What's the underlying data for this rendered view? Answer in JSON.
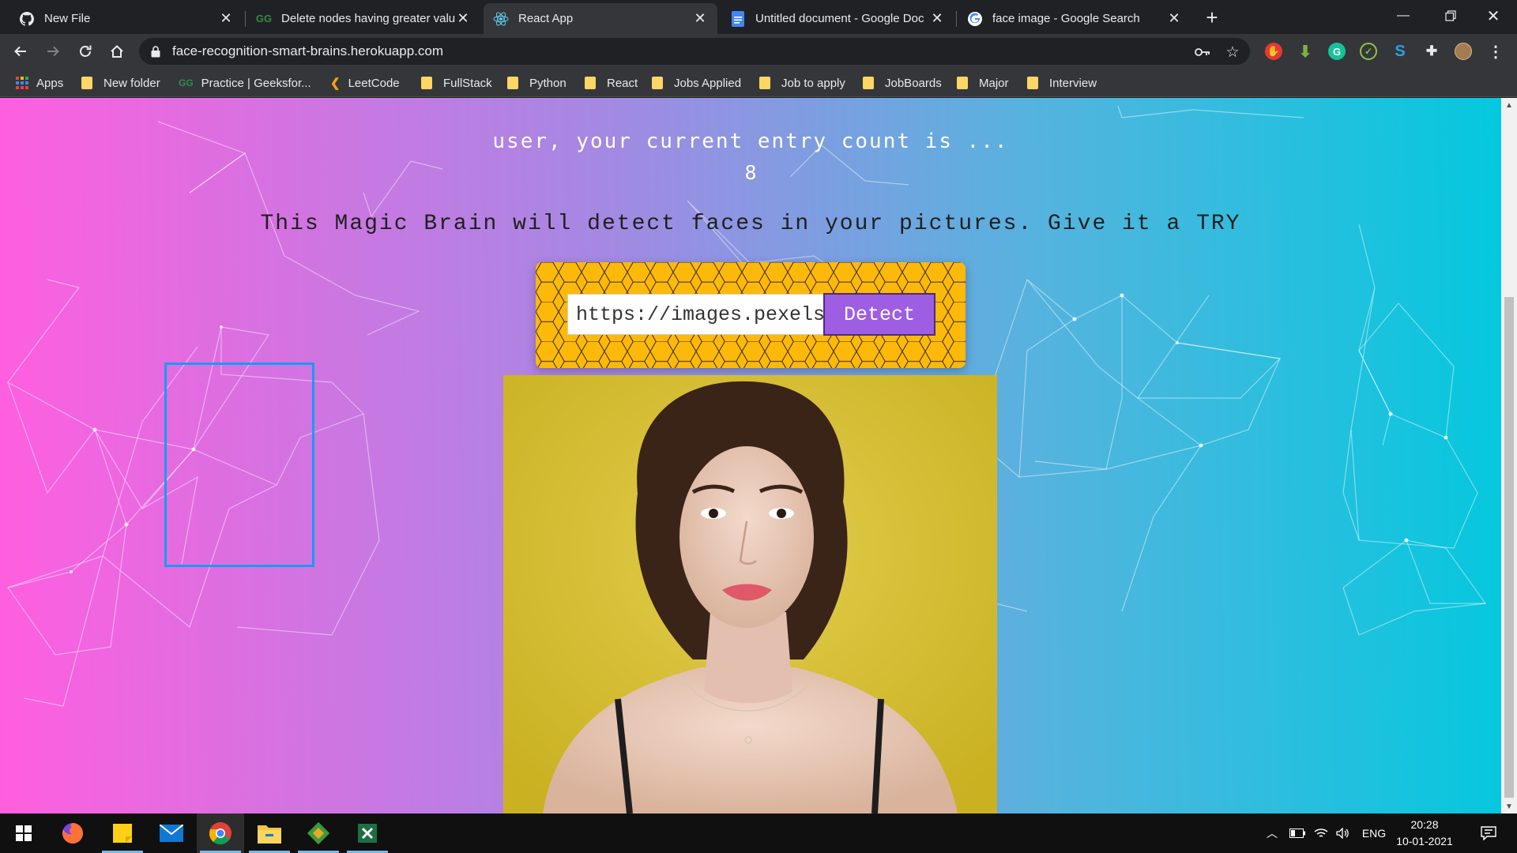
{
  "browser": {
    "tabs": [
      {
        "title": "New File",
        "icon": "github-icon"
      },
      {
        "title": "Delete nodes having greater valu",
        "icon": "geeksforgeeks-icon"
      },
      {
        "title": "React App",
        "icon": "react-icon",
        "active": true
      },
      {
        "title": "Untitled document - Google Doc",
        "icon": "google-docs-icon"
      },
      {
        "title": "face image - Google Search",
        "icon": "google-icon"
      }
    ],
    "url": "face-recognition-smart-brains.herokuapp.com",
    "bookmarks": [
      {
        "label": "Apps",
        "icon": "apps-grid-icon"
      },
      {
        "label": "New folder",
        "icon": "folder-icon"
      },
      {
        "label": "Practice | Geeksfor...",
        "icon": "geeksforgeeks-icon"
      },
      {
        "label": "LeetCode",
        "icon": "leetcode-icon"
      },
      {
        "label": "FullStack",
        "icon": "folder-icon"
      },
      {
        "label": "Python",
        "icon": "folder-icon"
      },
      {
        "label": "React",
        "icon": "folder-icon"
      },
      {
        "label": "Jobs Applied",
        "icon": "folder-icon"
      },
      {
        "label": "Job to apply",
        "icon": "folder-icon"
      },
      {
        "label": "JobBoards",
        "icon": "folder-icon"
      },
      {
        "label": "Major",
        "icon": "folder-icon"
      },
      {
        "label": "Interview",
        "icon": "folder-icon"
      }
    ]
  },
  "page": {
    "greeting": "user, your current entry count is ...",
    "entry_count": "8",
    "tagline": "This Magic Brain will detect faces in your pictures. Give it a TRY",
    "image_url_value": "https://images.pexels.com",
    "detect_label": "Detect"
  },
  "taskbar": {
    "apps": [
      "windows-start-icon",
      "firefox-icon",
      "sticky-notes-icon",
      "mail-icon",
      "chrome-icon",
      "file-explorer-icon",
      "git-icon",
      "excel-icon"
    ],
    "language": "ENG",
    "time": "20:28",
    "date": "10-01-2021"
  },
  "colors": {
    "gradient_left": "#ff5edf",
    "gradient_right": "#04c8de",
    "panel": "#fcb90a",
    "button": "#9e5ee3",
    "face_box": "#149df2"
  }
}
